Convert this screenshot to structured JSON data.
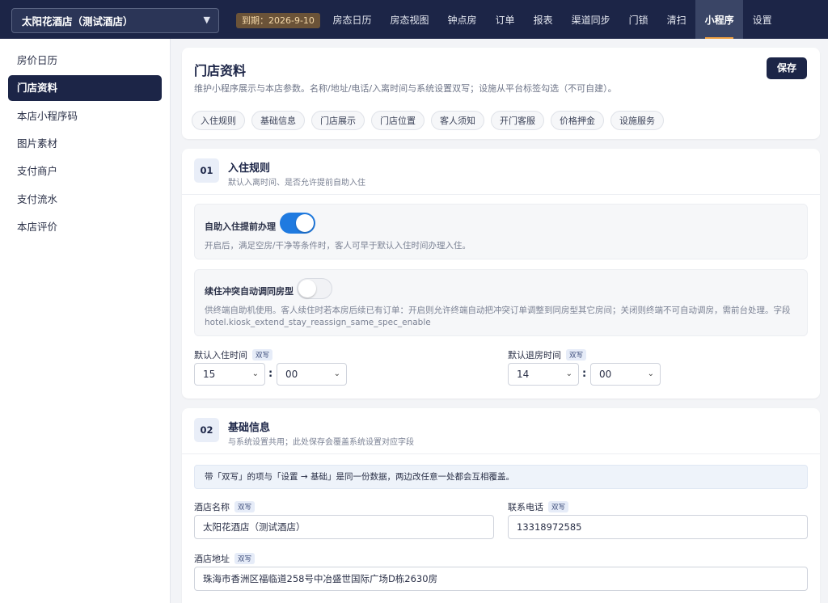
{
  "topbar": {
    "hotel_name": "太阳花酒店（测试酒店）",
    "expire": "到期：2026-9-10",
    "nav": [
      "房态日历",
      "房态视图",
      "钟点房",
      "订单",
      "报表",
      "渠道同步",
      "门锁",
      "清扫",
      "小程序",
      "设置"
    ],
    "active_nav": "小程序"
  },
  "sidebar": {
    "items": [
      "房价日历",
      "门店资料",
      "本店小程序码",
      "图片素材",
      "支付商户",
      "支付流水",
      "本店评价"
    ],
    "active": "门店资料"
  },
  "header": {
    "title": "门店资料",
    "desc": "维护小程序展示与本店参数。名称/地址/电话/入离时间与系统设置双写；设施从平台标签勾选（不可自建）。",
    "save_label": "保存",
    "chips": [
      "入住规则",
      "基础信息",
      "门店展示",
      "门店位置",
      "客人须知",
      "开门客服",
      "价格押金",
      "设施服务"
    ]
  },
  "section1": {
    "num": "01",
    "title": "入住规则",
    "sub": "默认入离时间、是否允许提前自助入住",
    "opt1": {
      "label": "自助入住提前办理",
      "on": true,
      "desc": "开启后，满足空房/干净等条件时，客人可早于默认入住时间办理入住。"
    },
    "opt2": {
      "label": "续住冲突自动调同房型",
      "on": false,
      "desc1": "供终端自助机使用。客人续住时若本房后续已有订单：开启则允许终端自动把冲突订单调整到同房型其它房间；关闭则终端不可自动调房，需前台处理。字段",
      "desc2": "hotel.kiosk_extend_stay_reassign_same_spec_enable"
    },
    "checkin_label": "默认入住时间",
    "checkout_label": "默认退房时间",
    "dual_tag": "双写",
    "checkin_hour": "15",
    "checkin_min": "00",
    "checkout_hour": "14",
    "checkout_min": "00"
  },
  "section2": {
    "num": "02",
    "title": "基础信息",
    "sub": "与系统设置共用；此处保存会覆盖系统设置对应字段",
    "info": "带「双写」的项与「设置 → 基础」是同一份数据，两边改任意一处都会互相覆盖。",
    "name_label": "酒店名称",
    "name_value": "太阳花酒店（测试酒店）",
    "phone_label": "联系电话",
    "phone_value": "13318972585",
    "addr_label": "酒店地址",
    "addr_value": "珠海市香洲区福临道258号中冶盛世国际广场D栋2630房",
    "dual_tag": "双写"
  }
}
